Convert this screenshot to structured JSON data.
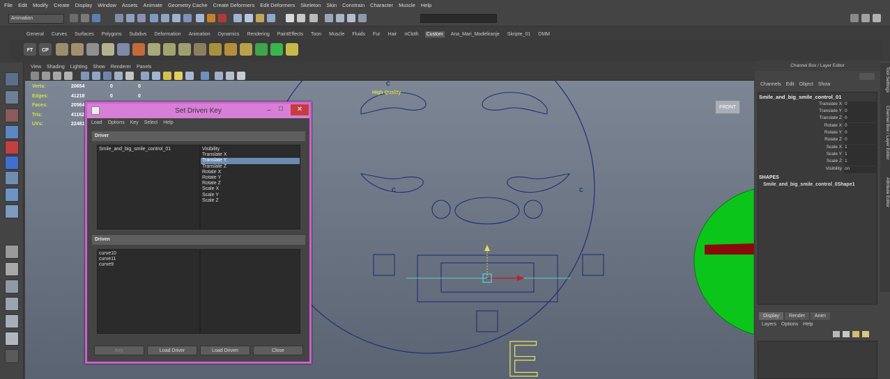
{
  "menubar": [
    "File",
    "Edit",
    "Modify",
    "Create",
    "Display",
    "Window",
    "Assets",
    "Animate",
    "Geometry Cache",
    "Create Deformers",
    "Edit Deformers",
    "Skeleton",
    "Skin",
    "Constrain",
    "Character",
    "Muscle",
    "Help"
  ],
  "status": {
    "mode": "Animation"
  },
  "shelf_tabs": [
    {
      "label": "General",
      "active": false
    },
    {
      "label": "Curves",
      "active": false
    },
    {
      "label": "Surfaces",
      "active": false
    },
    {
      "label": "Polygons",
      "active": false
    },
    {
      "label": "Subdivs",
      "active": false
    },
    {
      "label": "Deformation",
      "active": false
    },
    {
      "label": "Animation",
      "active": false
    },
    {
      "label": "Dynamics",
      "active": false
    },
    {
      "label": "Rendering",
      "active": false
    },
    {
      "label": "PaintEffects",
      "active": false
    },
    {
      "label": "Toon",
      "active": false
    },
    {
      "label": "Muscle",
      "active": false
    },
    {
      "label": "Fluids",
      "active": false
    },
    {
      "label": "Fur",
      "active": false
    },
    {
      "label": "Hair",
      "active": false
    },
    {
      "label": "nCloth",
      "active": false
    },
    {
      "label": "Custom",
      "active": true
    },
    {
      "label": "Ana_Mari_Modeliranje",
      "active": false
    },
    {
      "label": "Skripte_01",
      "active": false
    },
    {
      "label": "DMM",
      "active": false
    }
  ],
  "shelf_labels": {
    "ft": "FT",
    "cp": "CP"
  },
  "panel_menu": [
    "View",
    "Shading",
    "Lighting",
    "Show",
    "Renderer",
    "Panels"
  ],
  "hud": {
    "rows": [
      {
        "key": "Verts:",
        "value": "20654",
        "sel": "0",
        "comp": "0"
      },
      {
        "key": "Edges:",
        "value": "41218",
        "sel": "0",
        "comp": "0"
      },
      {
        "key": "Faces:",
        "value": "20564",
        "sel": "0",
        "comp": "0"
      },
      {
        "key": "Tris:",
        "value": "41162",
        "sel": "0",
        "comp": "0"
      },
      {
        "key": "UVs:",
        "value": "22481",
        "sel": "0",
        "comp": "0"
      }
    ],
    "quality": "High Quality",
    "view_cube": "FRONT"
  },
  "viewport_labels": {
    "c_top": "C",
    "c_left": "C",
    "c_right": "C",
    "letter": "E"
  },
  "sdk": {
    "title": "Set Driven Key",
    "menu": [
      "Load",
      "Options",
      "Key",
      "Select",
      "Help"
    ],
    "driver_header": "Driver",
    "driver_objects": [
      {
        "label": "Smile_and_big_smile_control_01",
        "selected": true
      }
    ],
    "driver_attrs": [
      {
        "label": "Visibility",
        "selected": false
      },
      {
        "label": "Translate X",
        "selected": false
      },
      {
        "label": "Translate Y",
        "selected": true
      },
      {
        "label": "Translate Z",
        "selected": false
      },
      {
        "label": "Rotate X",
        "selected": false
      },
      {
        "label": "Rotate Y",
        "selected": false
      },
      {
        "label": "Rotate Z",
        "selected": false
      },
      {
        "label": "Scale X",
        "selected": false
      },
      {
        "label": "Scale Y",
        "selected": false
      },
      {
        "label": "Scale Z",
        "selected": false
      }
    ],
    "driven_header": "Driven",
    "driven_objects": [
      "curve10",
      "curve11",
      "curve9"
    ],
    "buttons": {
      "key": "Key",
      "load_driver": "Load Driver",
      "load_driven": "Load Driven",
      "close": "Close"
    }
  },
  "channel_box": {
    "header": "Channel Box / Layer Editor",
    "menu": [
      "Channels",
      "Edit",
      "Object",
      "Show"
    ],
    "object": "Smile_and_big_smile_control_01",
    "attributes": [
      {
        "name": "Translate X",
        "value": "0"
      },
      {
        "name": "Translate Y",
        "value": "0"
      },
      {
        "name": "Translate Z",
        "value": "0"
      },
      {
        "name": "Rotate X",
        "value": "0"
      },
      {
        "name": "Rotate Y",
        "value": "0"
      },
      {
        "name": "Rotate Z",
        "value": "0"
      },
      {
        "name": "Scale X",
        "value": "1"
      },
      {
        "name": "Scale Y",
        "value": "1"
      },
      {
        "name": "Scale Z",
        "value": "1"
      },
      {
        "name": "Visibility",
        "value": "on"
      }
    ],
    "shapes_label": "SHAPES",
    "shape": "Smile_and_big_smile_control_0Shape1",
    "layer_tabs": [
      {
        "label": "Display",
        "active": true
      },
      {
        "label": "Render",
        "active": false
      },
      {
        "label": "Anim",
        "active": false
      }
    ],
    "layer_menu": [
      "Layers",
      "Options",
      "Help"
    ]
  },
  "side_tabs": [
    "Tool Settings",
    "Channel Box / Layer Editor",
    "Attribute Editor"
  ]
}
